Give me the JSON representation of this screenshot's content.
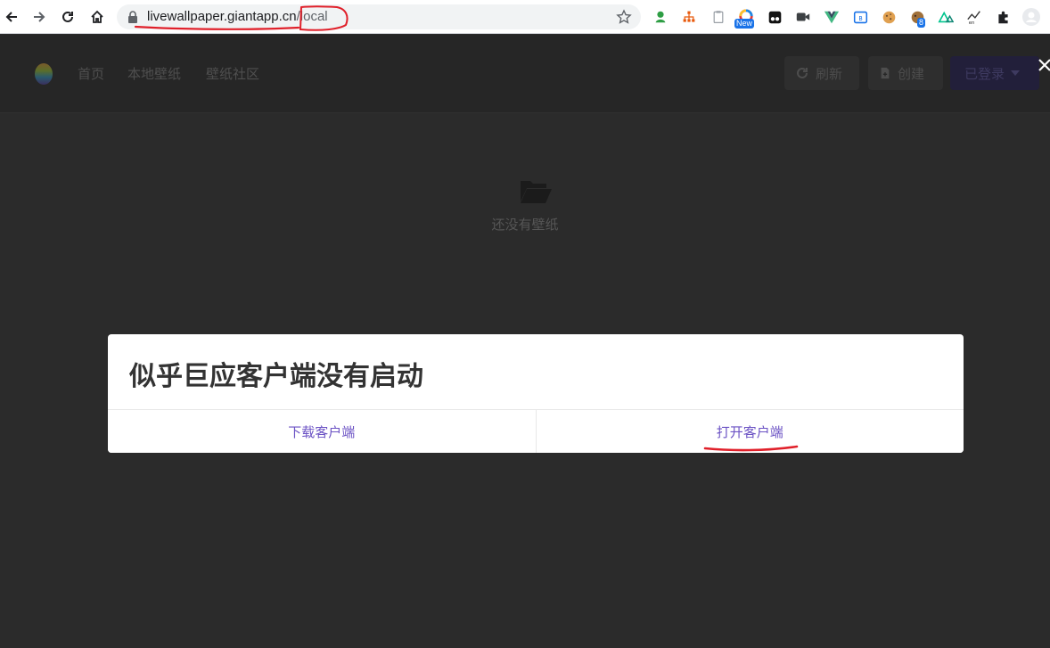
{
  "browser": {
    "url_host": "livewallpaper.giantapp.cn",
    "url_path": "/local",
    "extensions": [
      {
        "icon": "green-bird-icon"
      },
      {
        "icon": "sitemap-icon"
      },
      {
        "icon": "clipboard-icon"
      },
      {
        "icon": "color-wheel-icon",
        "badge": "New"
      },
      {
        "icon": "tampermonkey-icon"
      },
      {
        "icon": "video-camera-icon"
      },
      {
        "icon": "vue-devtools-icon"
      },
      {
        "icon": "code-box-icon"
      },
      {
        "icon": "cookie-icon"
      },
      {
        "icon": "cookie-editor-icon",
        "badge": "8"
      },
      {
        "icon": "nuxt-icon"
      },
      {
        "icon": "translate-icon"
      },
      {
        "icon": "puzzle-icon"
      },
      {
        "icon": "profile-avatar-icon"
      }
    ]
  },
  "app": {
    "nav": [
      "首页",
      "本地壁纸",
      "壁纸社区"
    ],
    "refresh_label": "刷新",
    "create_label": "创建",
    "login_label": "已登录"
  },
  "empty": {
    "text": "还没有壁纸"
  },
  "dialog": {
    "title": "似乎巨应客户端没有启动",
    "download_label": "下载客户端",
    "open_label": "打开客户端"
  },
  "colors": {
    "accent": "#6b52c4",
    "annotation": "#e0202a",
    "background": "#2b2b2b"
  }
}
